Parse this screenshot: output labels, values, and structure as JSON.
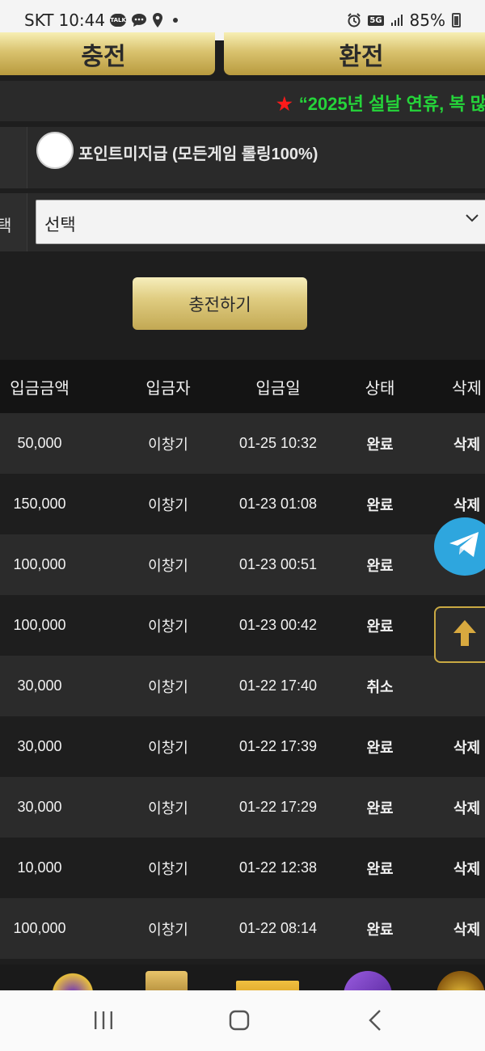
{
  "status_bar": {
    "carrier": "SKT",
    "time": "10:44",
    "network": "5G",
    "battery": "85%",
    "icons": [
      "talk-icon",
      "chat-icon",
      "location-icon",
      "alarm-icon",
      "signal-icon",
      "battery-icon"
    ]
  },
  "top_buttons": {
    "charge_label": "충전",
    "exchange_label": "환전"
  },
  "notice": {
    "star": "★",
    "text": "“2025년 설날 연휴, 복 많"
  },
  "form": {
    "point_option_label": "포인트미지급 (모든게임 롤링100%)",
    "select_label_fragment": "택",
    "select_value": "선택",
    "submit_label": "충전하기"
  },
  "table": {
    "headers": [
      "입금금액",
      "입금자",
      "입금일",
      "상태",
      "삭제"
    ],
    "rows": [
      {
        "amount": "50,000",
        "depositor": "이창기",
        "date": "01-25 10:32",
        "status": "완료",
        "delete": "삭제"
      },
      {
        "amount": "150,000",
        "depositor": "이창기",
        "date": "01-23 01:08",
        "status": "완료",
        "delete": "삭제"
      },
      {
        "amount": "100,000",
        "depositor": "이창기",
        "date": "01-23 00:51",
        "status": "완료",
        "delete": ""
      },
      {
        "amount": "100,000",
        "depositor": "이창기",
        "date": "01-23 00:42",
        "status": "완료",
        "delete": ""
      },
      {
        "amount": "30,000",
        "depositor": "이창기",
        "date": "01-22 17:40",
        "status": "취소",
        "delete": ""
      },
      {
        "amount": "30,000",
        "depositor": "이창기",
        "date": "01-22 17:39",
        "status": "완료",
        "delete": "삭제"
      },
      {
        "amount": "30,000",
        "depositor": "이창기",
        "date": "01-22 17:29",
        "status": "완료",
        "delete": "삭제"
      },
      {
        "amount": "10,000",
        "depositor": "이창기",
        "date": "01-22 12:38",
        "status": "완료",
        "delete": "삭제"
      },
      {
        "amount": "100,000",
        "depositor": "이창기",
        "date": "01-22 08:14",
        "status": "완료",
        "delete": "삭제"
      }
    ]
  },
  "floating": {
    "telegram_icon": "telegram-icon",
    "scroll_top_icon": "arrow-up-icon"
  },
  "colors": {
    "gold": "#d9c26e",
    "notice_green": "#25d43a",
    "notice_star_red": "#ff1a1a",
    "telegram_blue": "#2ea6de"
  }
}
